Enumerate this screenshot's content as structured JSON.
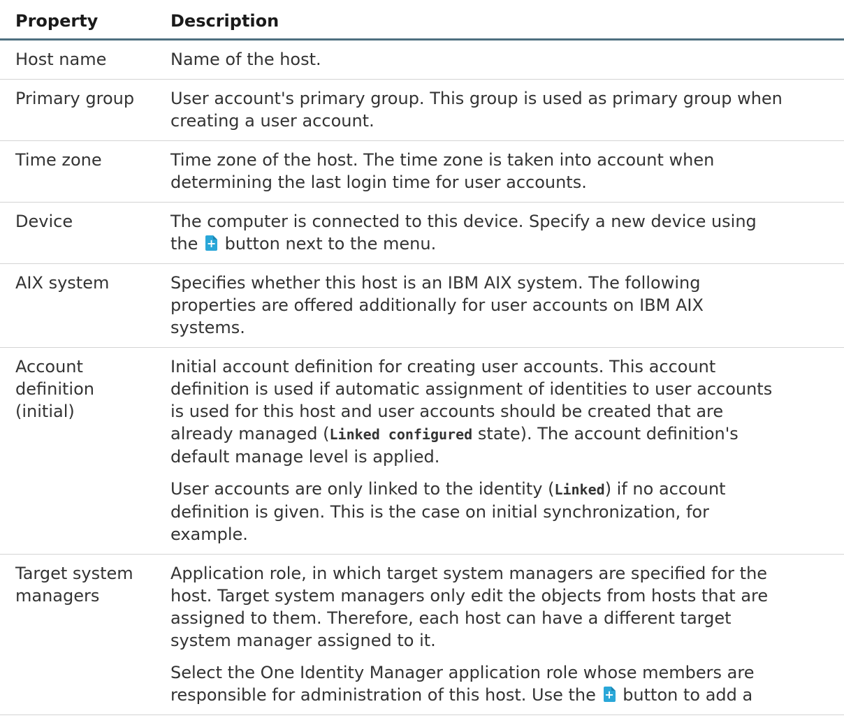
{
  "table": {
    "headers": {
      "property": "Property",
      "description": "Description"
    },
    "rows": [
      {
        "name": "Host name",
        "desc_lines": [
          "Name of the host."
        ]
      },
      {
        "name": "Primary group",
        "desc_lines": [
          "User account's primary group. This group is used as primary group when",
          "creating a user account."
        ]
      },
      {
        "name": "Time zone",
        "desc_lines": [
          "Time zone of the host. The time zone is taken into account when",
          "determining the last login time for user accounts."
        ]
      },
      {
        "name": "Device",
        "desc_line1": "The computer is connected to this device. Specify a new device using",
        "desc_line2_before": "the",
        "desc_line2_after": "button next to the menu."
      },
      {
        "name": "AIX system",
        "desc_lines": [
          "Specifies whether this host is an IBM AIX system. The following",
          "properties are offered additionally for user accounts on IBM AIX",
          "systems."
        ]
      },
      {
        "name_lines": [
          "Account",
          "definition",
          "(initial)"
        ],
        "p1_lines": [
          "Initial account definition for creating user accounts. This account",
          "definition is used if automatic assignment of identities to user accounts",
          "is used for this host and user accounts should be created that are"
        ],
        "p1_line4_before": "already managed (",
        "p1_line4_code": "Linked configured",
        "p1_line4_after": " state). The account definition's",
        "p1_line5": "default manage level is applied.",
        "p2_line1_before": "User accounts are only linked to the identity (",
        "p2_line1_code": "Linked",
        "p2_line1_after": ") if no account",
        "p2_lines": [
          "definition is given. This is the case on initial synchronization, for",
          "example."
        ]
      },
      {
        "name_lines": [
          "Target system",
          "managers"
        ],
        "p1_lines": [
          "Application role, in which target system managers are specified for the",
          "host. Target system managers only edit the objects from hosts that are",
          "assigned to them. Therefore, each host can have a different target",
          "system manager assigned to it."
        ],
        "p2_line1": "Select the One Identity Manager application role whose members are",
        "p2_line2_before": "responsible for administration of this host. Use the",
        "p2_line2_after": "button to add a"
      }
    ]
  }
}
